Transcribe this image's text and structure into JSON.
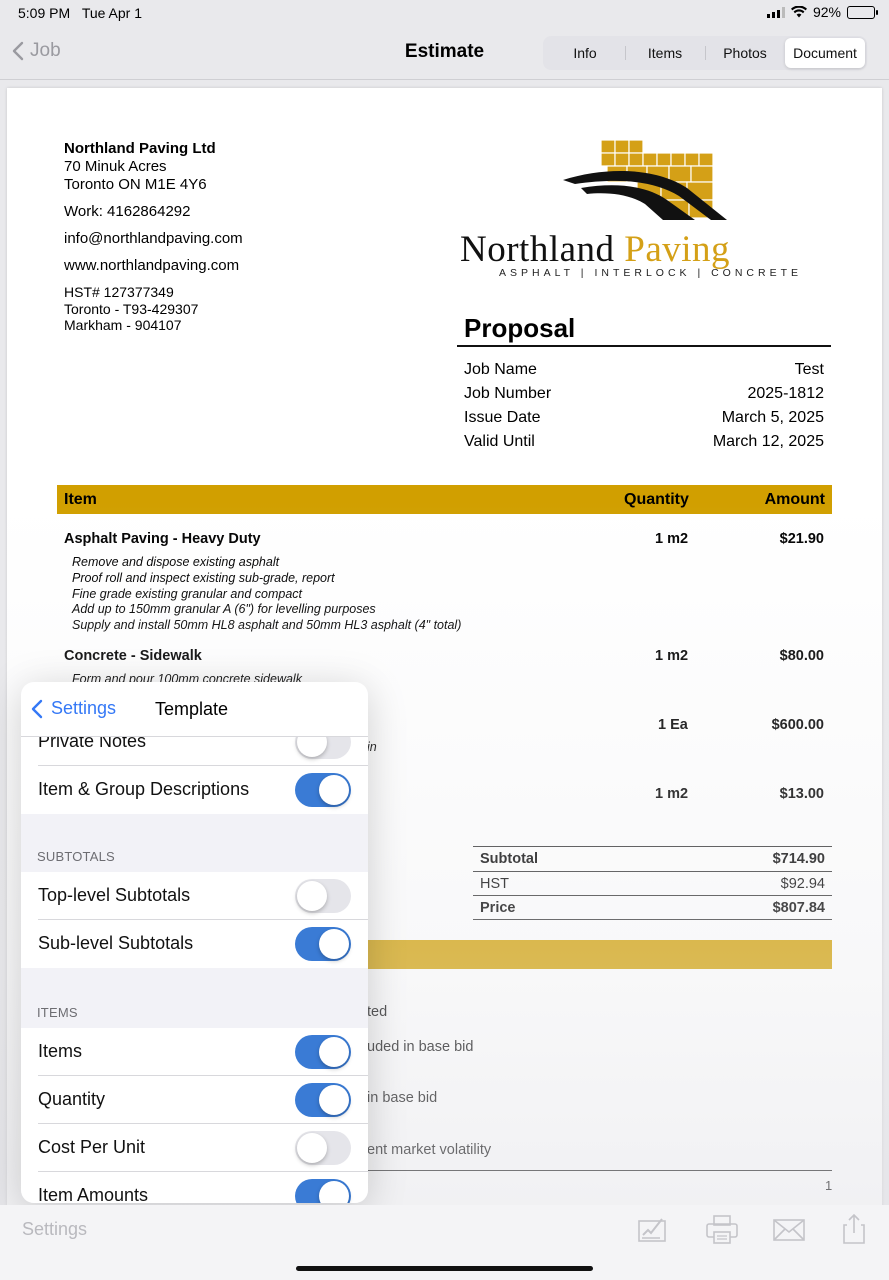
{
  "status_bar": {
    "time": "5:09 PM",
    "date": "Tue Apr 1",
    "battery": "92%",
    "battery_level": 0.92
  },
  "nav": {
    "back_label": "Job",
    "title": "Estimate",
    "tabs": [
      "Info",
      "Items",
      "Photos",
      "Document"
    ],
    "active_tab": "Document"
  },
  "document": {
    "company": {
      "name": "Northland Paving Ltd",
      "address1": "70 Minuk Acres",
      "address2": "Toronto ON M1E 4Y6",
      "work": "Work:  4162864292",
      "email": "info@northlandpaving.com",
      "website": "www.northlandpaving.com",
      "hst": "HST# 127377349",
      "toronto": "Toronto - T93-429307",
      "markham": "Markham - 904107"
    },
    "logo": {
      "word1": "Northland",
      "word2": "Paving",
      "tagline": "ASPHALT | INTERLOCK | CONCRETE",
      "gold": "#d4a017"
    },
    "proposal": {
      "title": "Proposal",
      "rows": [
        {
          "label": "Job Name",
          "value": "Test"
        },
        {
          "label": "Job Number",
          "value": "2025-1812"
        },
        {
          "label": "Issue Date",
          "value": "March 5, 2025"
        },
        {
          "label": "Valid Until",
          "value": "March 12, 2025"
        }
      ]
    },
    "items_header": {
      "item": "Item",
      "quantity": "Quantity",
      "amount": "Amount",
      "color": "#d19f00"
    },
    "items": [
      {
        "title": "Asphalt Paving - Heavy Duty",
        "quantity": "1 m2",
        "amount": "$21.90",
        "desc": [
          "Remove and dispose existing asphalt",
          "Proof roll and inspect existing sub-grade, report",
          "Fine grade existing granular and compact",
          "Add up to 150mm granular A (6\") for levelling purposes",
          "Supply and install 50mm HL8 asphalt and 50mm HL3 asphalt (4\" total)"
        ]
      },
      {
        "title": "Concrete - Sidewalk",
        "quantity": "1 m2",
        "amount": "$80.00",
        "desc": [
          "Form and pour 100mm concrete sidewalk"
        ]
      },
      {
        "title": "",
        "quantity": "1 Ea",
        "amount": "$600.00",
        "desc_fragment": "in"
      },
      {
        "title": "",
        "quantity": "1 m2",
        "amount": "$13.00"
      }
    ],
    "totals": {
      "subtotal_label": "Subtotal",
      "subtotal": "$714.90",
      "hst_label": "HST",
      "hst": "$92.94",
      "price_label": "Price",
      "price": "$807.84"
    },
    "terms_fragments": [
      "ted",
      "uded in base bid",
      "in base bid",
      "ent market volatility"
    ],
    "page_number": "1"
  },
  "popover": {
    "back_label": "Settings",
    "title": "Template",
    "rows_top": [
      {
        "label": "Private Notes",
        "on": false
      },
      {
        "label": "Item & Group Descriptions",
        "on": true
      }
    ],
    "section_subtotals": "SUBTOTALS",
    "rows_subtotals": [
      {
        "label": "Top-level Subtotals",
        "on": false
      },
      {
        "label": "Sub-level Subtotals",
        "on": true
      }
    ],
    "section_items": "ITEMS",
    "rows_items": [
      {
        "label": "Items",
        "on": true
      },
      {
        "label": "Quantity",
        "on": true
      },
      {
        "label": "Cost Per Unit",
        "on": false
      },
      {
        "label": "Item Amounts",
        "on": true
      }
    ],
    "toggle_on_color": "#3a7bd5"
  },
  "toolbar": {
    "settings_label": "Settings",
    "icons": [
      "signature-icon",
      "print-icon",
      "mail-icon",
      "share-icon"
    ]
  }
}
